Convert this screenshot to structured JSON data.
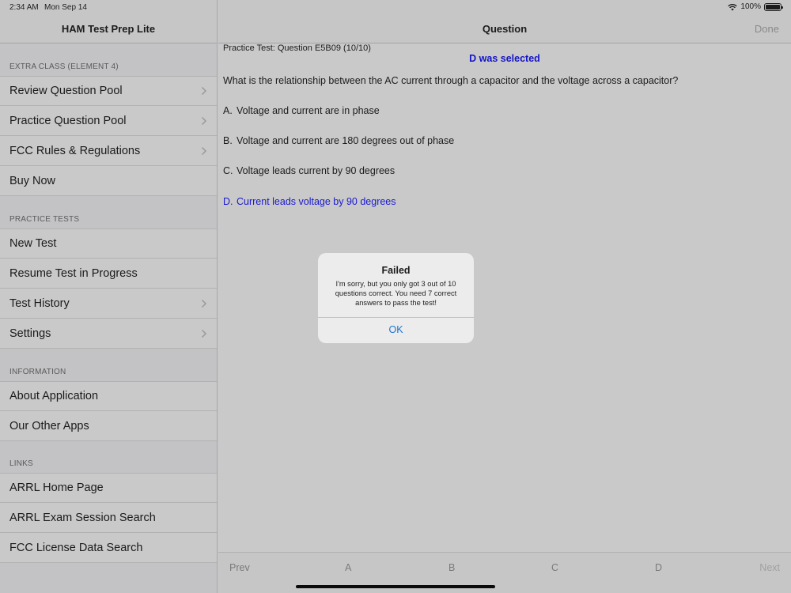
{
  "status": {
    "time": "2:34 AM",
    "date": "Mon Sep 14",
    "battery": "100%"
  },
  "sidebar": {
    "title": "HAM Test Prep Lite",
    "sections": [
      {
        "header": "EXTRA CLASS (ELEMENT 4)",
        "items": [
          {
            "label": "Review Question Pool",
            "chevron": true
          },
          {
            "label": "Practice Question Pool",
            "chevron": true
          },
          {
            "label": "FCC Rules & Regulations",
            "chevron": true
          },
          {
            "label": "Buy Now",
            "chevron": false
          }
        ]
      },
      {
        "header": "PRACTICE TESTS",
        "items": [
          {
            "label": "New Test",
            "chevron": false
          },
          {
            "label": "Resume Test in Progress",
            "chevron": false
          },
          {
            "label": "Test History",
            "chevron": true
          },
          {
            "label": "Settings",
            "chevron": true
          }
        ]
      },
      {
        "header": "INFORMATION",
        "items": [
          {
            "label": "About Application",
            "chevron": false
          },
          {
            "label": "Our Other Apps",
            "chevron": false
          }
        ]
      },
      {
        "header": "LINKS",
        "items": [
          {
            "label": "ARRL Home Page",
            "chevron": false
          },
          {
            "label": "ARRL Exam Session Search",
            "chevron": false
          },
          {
            "label": "FCC License Data Search",
            "chevron": false
          }
        ]
      }
    ]
  },
  "main": {
    "nav_title": "Question",
    "done_label": "Done",
    "question_id": "Practice Test:  Question E5B09 (10/10)",
    "selected_banner": "D was selected",
    "question_text": "What is the relationship between the AC current through a capacitor and the voltage across a capacitor?",
    "answers": [
      {
        "letter": "A.",
        "text": "Voltage and current are in phase"
      },
      {
        "letter": "B.",
        "text": "Voltage and current are 180 degrees out of phase"
      },
      {
        "letter": "C.",
        "text": "Voltage leads current by 90 degrees"
      },
      {
        "letter": "D.",
        "text": "Current leads voltage by 90 degrees"
      }
    ],
    "selected_answer": "D"
  },
  "bottom_bar": {
    "prev": "Prev",
    "a": "A",
    "b": "B",
    "c": "C",
    "d": "D",
    "next": "Next"
  },
  "alert": {
    "title": "Failed",
    "message": "I'm sorry, but you only got 3 out of 10 questions correct.  You need 7 correct answers to pass the test!",
    "ok_label": "OK"
  },
  "colors": {
    "selected": "#1a1ad0",
    "link": "#1a73d6"
  }
}
